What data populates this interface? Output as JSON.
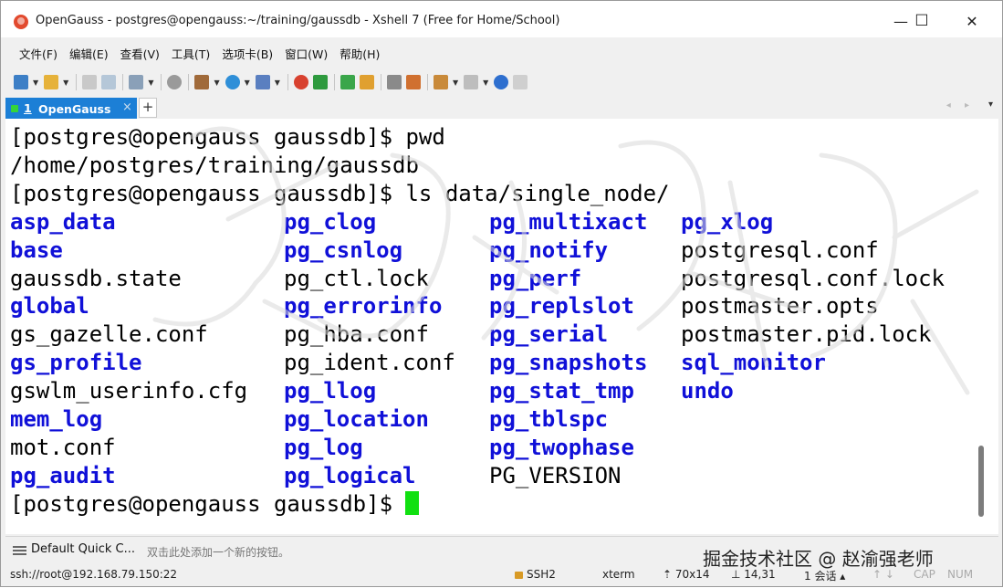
{
  "window": {
    "title": "OpenGauss - postgres@opengauss:~/training/gaussdb - Xshell 7 (Free for Home/School)",
    "controls": {
      "minimize": "—",
      "maximize": "☐",
      "close": "✕"
    }
  },
  "menu": [
    "文件(F)",
    "编辑(E)",
    "查看(V)",
    "工具(T)",
    "选项卡(B)",
    "窗口(W)",
    "帮助(H)"
  ],
  "tab": {
    "number": "1",
    "label": "OpenGauss",
    "close": "×",
    "add": "+",
    "nav": "◂ ▸",
    "menu": "▾"
  },
  "terminal": {
    "lines": [
      {
        "type": "text",
        "text": "[postgres@opengauss gaussdb]$ pwd"
      },
      {
        "type": "text",
        "text": "/home/postgres/training/gaussdb"
      },
      {
        "type": "text",
        "text": "[postgres@opengauss gaussdb]$ ls data/single_node/"
      },
      {
        "type": "cols",
        "cells": [
          {
            "t": "asp_data",
            "d": true
          },
          {
            "t": "pg_clog",
            "d": true
          },
          {
            "t": "pg_multixact",
            "d": true
          },
          {
            "t": "pg_xlog",
            "d": true
          }
        ]
      },
      {
        "type": "cols",
        "cells": [
          {
            "t": "base",
            "d": true
          },
          {
            "t": "pg_csnlog",
            "d": true
          },
          {
            "t": "pg_notify",
            "d": true
          },
          {
            "t": "postgresql.conf",
            "d": false
          }
        ]
      },
      {
        "type": "cols",
        "cells": [
          {
            "t": "gaussdb.state",
            "d": false
          },
          {
            "t": "pg_ctl.lock",
            "d": false
          },
          {
            "t": "pg_perf",
            "d": true
          },
          {
            "t": "postgresql.conf.lock",
            "d": false
          }
        ]
      },
      {
        "type": "cols",
        "cells": [
          {
            "t": "global",
            "d": true
          },
          {
            "t": "pg_errorinfo",
            "d": true
          },
          {
            "t": "pg_replslot",
            "d": true
          },
          {
            "t": "postmaster.opts",
            "d": false
          }
        ]
      },
      {
        "type": "cols",
        "cells": [
          {
            "t": "gs_gazelle.conf",
            "d": false
          },
          {
            "t": "pg_hba.conf",
            "d": false
          },
          {
            "t": "pg_serial",
            "d": true
          },
          {
            "t": "postmaster.pid.lock",
            "d": false
          }
        ]
      },
      {
        "type": "cols",
        "cells": [
          {
            "t": "gs_profile",
            "d": true
          },
          {
            "t": "pg_ident.conf",
            "d": false
          },
          {
            "t": "pg_snapshots",
            "d": true
          },
          {
            "t": "sql_monitor",
            "d": true
          }
        ]
      },
      {
        "type": "cols",
        "cells": [
          {
            "t": "gswlm_userinfo.cfg",
            "d": false
          },
          {
            "t": "pg_llog",
            "d": true
          },
          {
            "t": "pg_stat_tmp",
            "d": true
          },
          {
            "t": "undo",
            "d": true
          }
        ]
      },
      {
        "type": "cols",
        "cells": [
          {
            "t": "mem_log",
            "d": true
          },
          {
            "t": "pg_location",
            "d": true
          },
          {
            "t": "pg_tblspc",
            "d": true
          }
        ]
      },
      {
        "type": "cols",
        "cells": [
          {
            "t": "mot.conf",
            "d": false
          },
          {
            "t": "pg_log",
            "d": true
          },
          {
            "t": "pg_twophase",
            "d": true
          }
        ]
      },
      {
        "type": "cols",
        "cells": [
          {
            "t": "pg_audit",
            "d": true
          },
          {
            "t": "pg_logical",
            "d": true
          },
          {
            "t": "PG_VERSION",
            "d": false
          }
        ]
      },
      {
        "type": "prompt",
        "text": "[postgres@opengauss gaussdb]$ "
      }
    ]
  },
  "quickbar": {
    "label": "Default Quick C...",
    "hint": "双击此处添加一个新的按钮。"
  },
  "credit": "掘金技术社区 @ 赵渝强老师",
  "status": {
    "connection": "ssh://root@192.168.79.150:22",
    "protocol": "SSH2",
    "term": "xterm",
    "size": "70x14",
    "pos": "14,31",
    "sessions": "1 会话",
    "caps": "CAP",
    "num": "NUM"
  },
  "colors": {
    "dir": "#1010d8",
    "cursor": "#11e011",
    "tab": "#1c7fd6"
  }
}
